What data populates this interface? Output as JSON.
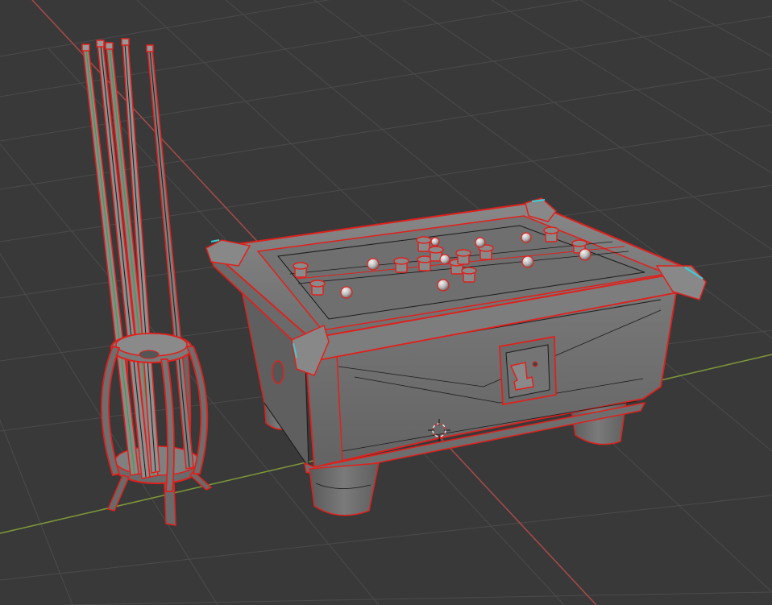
{
  "viewport": {
    "mode": "3d-viewport-wireframe-overlay",
    "background_color": "#393939",
    "grid_color": "#4a4a4a",
    "x_axis_color": "#a84a4a",
    "y_axis_color": "#7f9a38",
    "selection_outline_color": "#e0201c",
    "mesh_fill_color": "#6b6b6b",
    "edge_color": "#1a1a1a"
  },
  "objects": [
    {
      "name": "cue-rack",
      "selected": true
    },
    {
      "name": "pool-table",
      "selected": true
    }
  ],
  "overlay": {
    "cursor_3d_icon": "crosshair-circle-icon"
  }
}
